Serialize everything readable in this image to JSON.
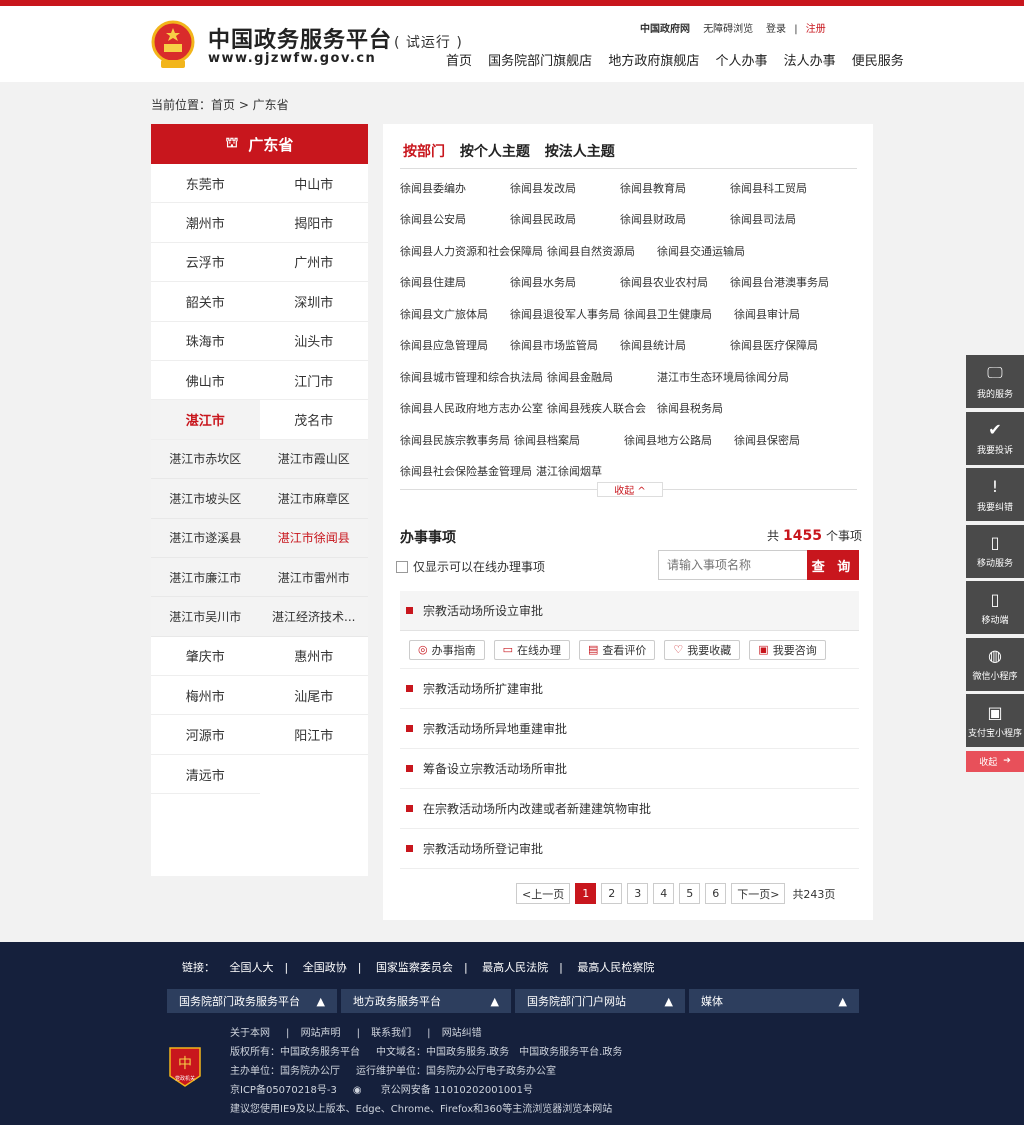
{
  "header": {
    "title": "中国政务服务平台",
    "trial": "( 试运行 )",
    "url": "www.gjzwfw.gov.cn",
    "top_links": [
      "中国政府网",
      "无障碍浏览"
    ],
    "login": "登录",
    "separator": "|",
    "register": "注册",
    "nav": [
      "首页",
      "国务院部门旗舰店",
      "地方政府旗舰店",
      "个人办事",
      "法人办事",
      "便民服务"
    ]
  },
  "breadcrumb": "当前位置：首页 > 广东省",
  "left_panel": {
    "title": "广东省",
    "cities_top": [
      "东莞市",
      "中山市",
      "潮州市",
      "揭阳市",
      "云浮市",
      "广州市",
      "韶关市",
      "深圳市",
      "珠海市",
      "汕头市",
      "佛山市",
      "江门市"
    ],
    "active_city": "湛江市",
    "city_after_active": "茂名市",
    "sub_districts": [
      "湛江市赤坎区",
      "湛江市霞山区",
      "湛江市坡头区",
      "湛江市麻章区",
      "湛江市遂溪县",
      "湛江市徐闻县",
      "湛江市廉江市",
      "湛江市雷州市",
      "湛江市吴川市",
      "湛江经济技术..."
    ],
    "active_sub": "湛江市徐闻县",
    "cities_bottom": [
      "肇庆市",
      "惠州市",
      "梅州市",
      "汕尾市",
      "河源市",
      "阳江市",
      "清远市"
    ]
  },
  "right_panel": {
    "tabs": [
      "按部门",
      "按个人主题",
      "按法人主题"
    ],
    "departments": [
      [
        "徐闻县委编办",
        "徐闻县发改局",
        "徐闻县教育局",
        "徐闻县科工贸局"
      ],
      [
        "徐闻县公安局",
        "徐闻县民政局",
        "徐闻县财政局",
        "徐闻县司法局"
      ],
      [
        "徐闻县人力资源和社会保障局",
        "徐闻县自然资源局",
        "徐闻县交通运输局"
      ],
      [
        "徐闻县住建局",
        "徐闻县水务局",
        "徐闻县农业农村局",
        "徐闻县台港澳事务局"
      ],
      [
        "徐闻县文广旅体局",
        "徐闻县退役军人事务局",
        "徐闻县卫生健康局",
        "徐闻县审计局"
      ],
      [
        "徐闻县应急管理局",
        "徐闻县市场监管局",
        "徐闻县统计局",
        "徐闻县医疗保障局"
      ],
      [
        "徐闻县城市管理和综合执法局",
        "徐闻县金融局",
        "湛江市生态环境局徐闻分局"
      ],
      [
        "徐闻县人民政府地方志办公室",
        "徐闻县残疾人联合会",
        "徐闻县税务局"
      ],
      [
        "徐闻县民族宗教事务局",
        "徐闻县档案局",
        "徐闻县地方公路局",
        "徐闻县保密局"
      ],
      [
        "徐闻县社会保险基金管理局",
        "湛江徐闻烟草"
      ]
    ],
    "collapse_label": "收起 ^",
    "items_title": "办事事项",
    "count_prefix": "共",
    "count": "1455",
    "count_suffix": "个事项",
    "online_only": "仅显示可以在线办理事项",
    "search_placeholder": "请输入事项名称",
    "search_button": "查 询",
    "items": [
      "宗教活动场所设立审批",
      "宗教活动场所扩建审批",
      "宗教活动场所异地重建审批",
      "筹备设立宗教活动场所审批",
      "在宗教活动场所内改建或者新建建筑物审批",
      "宗教活动场所登记审批"
    ],
    "actions": [
      "办事指南",
      "在线办理",
      "查看评价",
      "我要收藏",
      "我要咨询"
    ],
    "pager": {
      "prev": "<上一页",
      "pages": [
        "1",
        "2",
        "3",
        "4",
        "5",
        "6"
      ],
      "next": "下一页>",
      "total": "共243页"
    }
  },
  "sidebar": {
    "items": [
      "我的服务",
      "我要投诉",
      "我要纠错",
      "移动服务",
      "移动端",
      "微信小程序",
      "支付宝小程序"
    ],
    "collapse": "收起"
  },
  "footer": {
    "links_label": "链接：",
    "links": [
      "全国人大",
      "全国政协",
      "国家监察委员会",
      "最高人民法院",
      "最高人民检察院"
    ],
    "bars": [
      "国务院部门政务服务平台",
      "地方政务服务平台",
      "国务院部门门户网站",
      "媒体"
    ],
    "info_links": [
      "关于本网",
      "网站声明",
      "联系我们",
      "网站纠错"
    ],
    "copyright": "版权所有：中国政务服务平台",
    "domain": "中文域名：中国政务服务.政务　中国政务服务平台.政务",
    "host": "主办单位：国务院办公厅",
    "operator": "运行维护单位：国务院办公厅电子政务办公室",
    "icp": "京ICP备05070218号-3",
    "police": "京公网安备 11010202001001号",
    "browser": "建议您使用IE9及以上版本、Edge、Chrome、Firefox和360等主流浏览器浏览本网站",
    "badge_text": "党政机关"
  },
  "colors": {
    "primary": "#c8161d",
    "footer_bg": "#15203c",
    "sidebar_bg": "#4a4a4a"
  }
}
